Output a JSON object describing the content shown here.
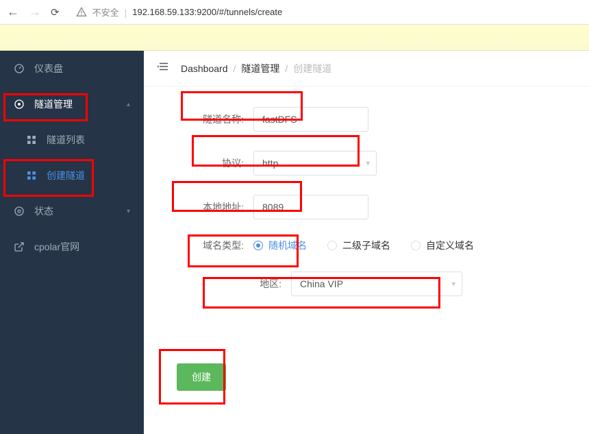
{
  "browser": {
    "insecure_label": "不安全",
    "url": "192.168.59.133:9200/#/tunnels/create"
  },
  "sidebar": {
    "items": [
      {
        "label": "仪表盘",
        "icon": "dashboard"
      },
      {
        "label": "隧道管理",
        "icon": "compass",
        "expanded": true,
        "children": [
          {
            "label": "隧道列表",
            "active": false
          },
          {
            "label": "创建隧道",
            "active": true
          }
        ]
      },
      {
        "label": "状态",
        "icon": "circle"
      },
      {
        "label": "cpolar官网",
        "icon": "external"
      }
    ]
  },
  "header": {
    "crumb1": "Dashboard",
    "crumb2": "隧道管理",
    "crumb3": "创建隧道"
  },
  "form": {
    "tunnel_name": {
      "label": "隧道名称:",
      "value": "fastDFS"
    },
    "protocol": {
      "label": "协议:",
      "value": "http"
    },
    "local_addr": {
      "label": "本地地址:",
      "value": "8089"
    },
    "domain_type": {
      "label": "域名类型:",
      "options": [
        "随机域名",
        "二级子域名",
        "自定义域名"
      ],
      "selected": 0
    },
    "region": {
      "label": "地区:",
      "value": "China VIP"
    },
    "submit": "创建"
  }
}
